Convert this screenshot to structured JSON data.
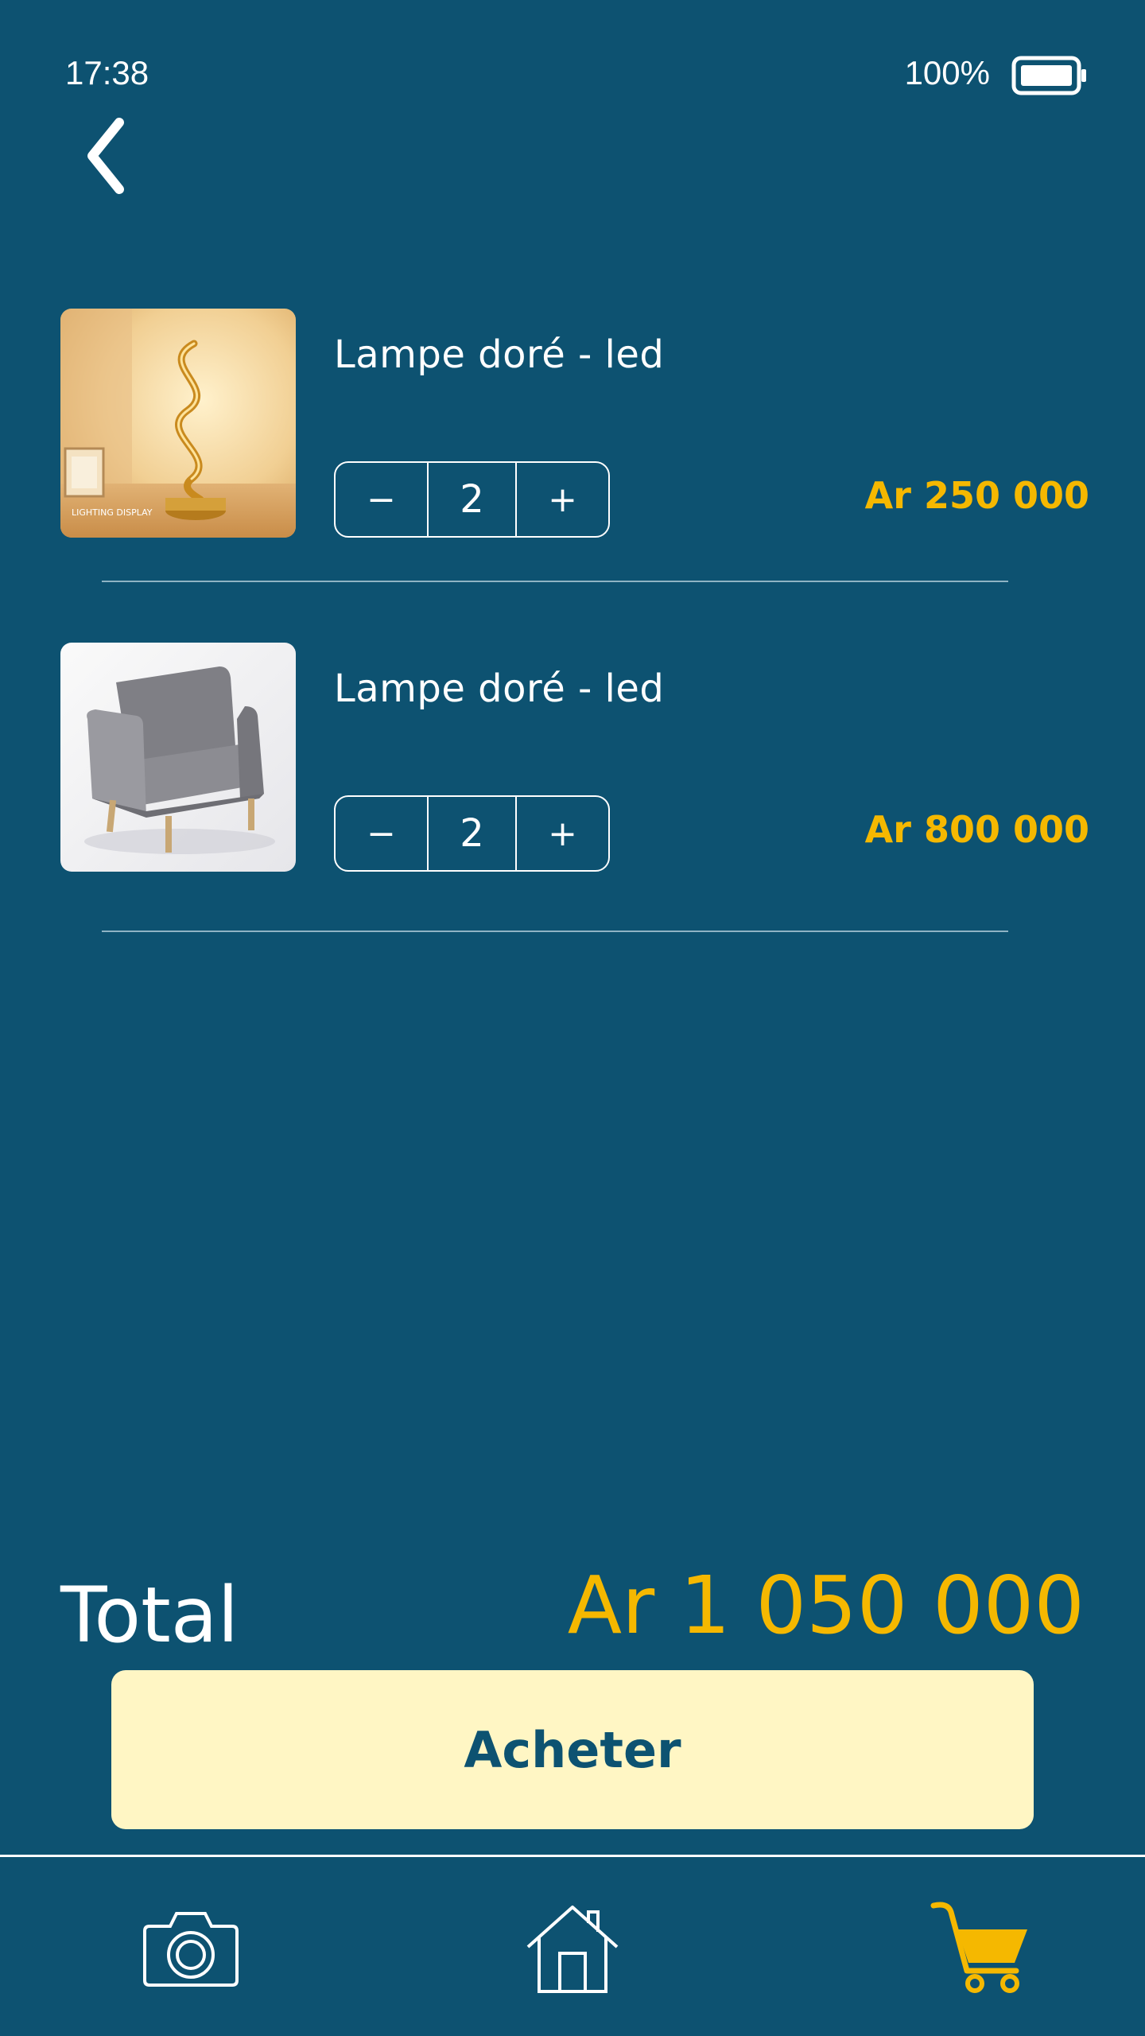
{
  "status_bar": {
    "time": "17:38",
    "battery": "100%"
  },
  "cart": {
    "items": [
      {
        "name": "Lampe doré - led",
        "quantity": "2",
        "price": "Ar 250 000",
        "minus": "−",
        "plus": "+",
        "image_caption": "LIGHTING DISPLAY"
      },
      {
        "name": "Lampe doré - led",
        "quantity": "2",
        "price": "Ar 800 000",
        "minus": "−",
        "plus": "+"
      }
    ]
  },
  "total": {
    "label": "Total",
    "value": "Ar 1 050 000"
  },
  "buy_button": {
    "label": "Acheter"
  },
  "bottom_nav": {
    "items": [
      {
        "icon": "camera-icon"
      },
      {
        "icon": "home-icon"
      },
      {
        "icon": "cart-icon",
        "active": true
      }
    ]
  },
  "colors": {
    "background": "#0d5271",
    "accent": "#f5b800",
    "button_bg": "#fff6c4"
  }
}
